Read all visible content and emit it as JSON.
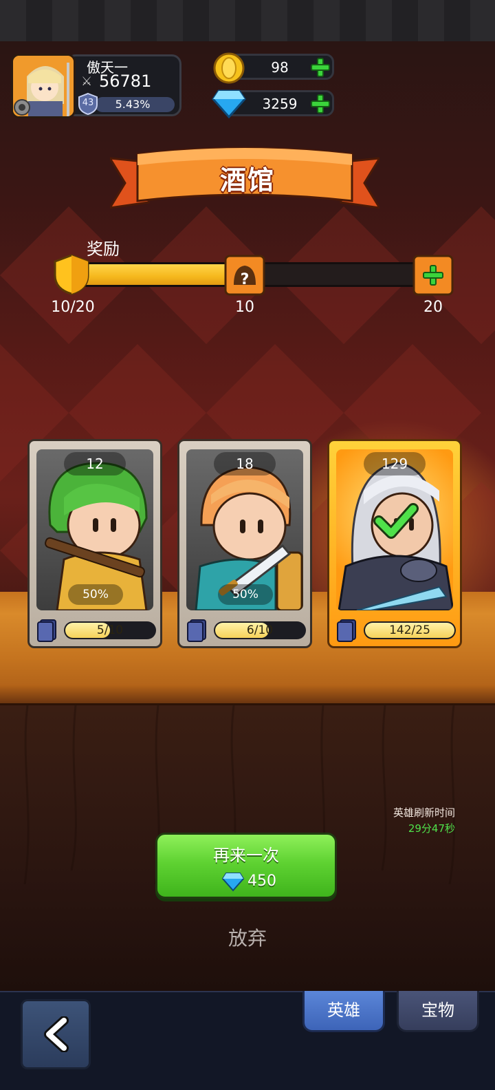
{
  "player": {
    "name": "傲天一",
    "power": "56781",
    "level": "43",
    "exp_percent": "5.43%"
  },
  "currency": {
    "gold": "98",
    "gems": "3259"
  },
  "title": "酒馆",
  "rewards": {
    "label": "奖励",
    "progress": "10/20",
    "progress_fraction": 0.5,
    "milestone_1": "10",
    "milestone_2": "20"
  },
  "heroes": [
    {
      "count": "12",
      "percent": "50%",
      "fragments": "5/10",
      "fraction": 0.5,
      "selected": false
    },
    {
      "count": "18",
      "percent": "50%",
      "fragments": "6/10",
      "fraction": 0.6,
      "selected": false
    },
    {
      "count": "129",
      "percent": "",
      "fragments": "142/25",
      "fraction": 1.0,
      "selected": true
    }
  ],
  "refresh": {
    "label": "英雄刷新时间",
    "time": "29分47秒"
  },
  "actions": {
    "again_label": "再来一次",
    "again_cost": "450",
    "abandon_label": "放弃"
  },
  "tabs": {
    "heroes": "英雄",
    "treasure": "宝物"
  },
  "colors": {
    "accent_green": "#4fe14a",
    "gold_bar": "#f5b81d",
    "tab_active": "#4a72c8"
  }
}
